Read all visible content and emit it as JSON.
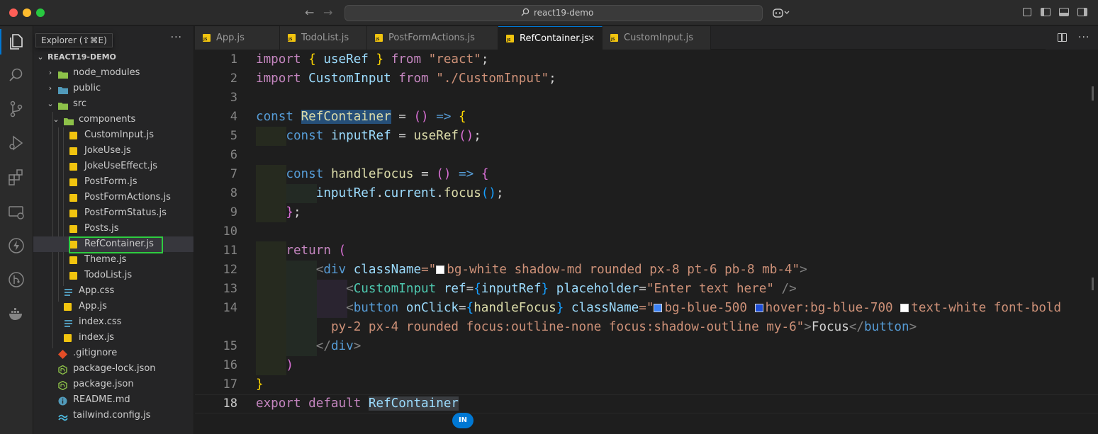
{
  "window": {
    "command_center_text": "react19-demo"
  },
  "explorer": {
    "tooltip": "Explorer (⇧⌘E)",
    "root": "REACT19-DEMO",
    "items": [
      {
        "label": "node_modules",
        "type": "folder",
        "expanded": false,
        "depth": 1,
        "icon": "folder-node-icon"
      },
      {
        "label": "public",
        "type": "folder",
        "expanded": false,
        "depth": 1,
        "icon": "folder-public-icon"
      },
      {
        "label": "src",
        "type": "folder",
        "expanded": true,
        "depth": 1,
        "icon": "folder-src-icon"
      },
      {
        "label": "components",
        "type": "folder",
        "expanded": true,
        "depth": 2,
        "icon": "folder-components-icon"
      },
      {
        "label": "CustomInput.js",
        "type": "js",
        "depth": 3
      },
      {
        "label": "JokeUse.js",
        "type": "js",
        "depth": 3
      },
      {
        "label": "JokeUseEffect.js",
        "type": "js",
        "depth": 3
      },
      {
        "label": "PostForm.js",
        "type": "js",
        "depth": 3
      },
      {
        "label": "PostFormActions.js",
        "type": "js",
        "depth": 3
      },
      {
        "label": "PostFormStatus.js",
        "type": "js",
        "depth": 3
      },
      {
        "label": "Posts.js",
        "type": "js",
        "depth": 3
      },
      {
        "label": "RefContainer.js",
        "type": "js",
        "depth": 3,
        "selected": true
      },
      {
        "label": "Theme.js",
        "type": "js",
        "depth": 3
      },
      {
        "label": "TodoList.js",
        "type": "js",
        "depth": 3
      },
      {
        "label": "App.css",
        "type": "css",
        "depth": 2
      },
      {
        "label": "App.js",
        "type": "js",
        "depth": 2
      },
      {
        "label": "index.css",
        "type": "css",
        "depth": 2
      },
      {
        "label": "index.js",
        "type": "js",
        "depth": 2
      },
      {
        "label": ".gitignore",
        "type": "git",
        "depth": 1
      },
      {
        "label": "package-lock.json",
        "type": "npm",
        "depth": 1
      },
      {
        "label": "package.json",
        "type": "npm",
        "depth": 1
      },
      {
        "label": "README.md",
        "type": "info",
        "depth": 1
      },
      {
        "label": "tailwind.config.js",
        "type": "tailwind",
        "depth": 1
      }
    ]
  },
  "tabs": [
    {
      "label": "App.js",
      "active": false
    },
    {
      "label": "TodoList.js",
      "active": false
    },
    {
      "label": "PostFormActions.js",
      "active": false
    },
    {
      "label": "RefContainer.js",
      "active": true
    },
    {
      "label": "CustomInput.js",
      "active": false
    }
  ],
  "tab_close_glyph": "✕",
  "editor": {
    "line_numbers": [
      "1",
      "2",
      "3",
      "4",
      "5",
      "6",
      "7",
      "8",
      "9",
      "10",
      "11",
      "12",
      "13",
      "14",
      "15",
      "16",
      "17",
      "18"
    ],
    "l1": {
      "a": "import",
      "b": "{",
      "c": "useRef",
      "d": "}",
      "e": "from",
      "f": "\"react\"",
      "g": ";"
    },
    "l2": {
      "a": "import",
      "b": "CustomInput",
      "c": "from",
      "d": "\"./CustomInput\"",
      "e": ";"
    },
    "l4": {
      "a": "const",
      "b": "RefContainer",
      "c": "=",
      "d": "()",
      "e": "=>",
      "f": "{"
    },
    "l5": {
      "a": "const",
      "b": "inputRef",
      "c": "=",
      "d": "useRef",
      "e": "()",
      "f": ";"
    },
    "l7": {
      "a": "const",
      "b": "handleFocus",
      "c": "=",
      "d": "()",
      "e": "=>",
      "f": "{"
    },
    "l8": {
      "a": "inputRef",
      "b": ".",
      "c": "current",
      "d": ".",
      "e": "focus",
      "f": "()",
      "g": ";"
    },
    "l9": {
      "a": "}",
      "b": ";"
    },
    "l11": {
      "a": "return",
      "b": "("
    },
    "l12": {
      "a": "<",
      "b": "div",
      "c": "className",
      "d": "=\"",
      "e": "bg-white shadow-md rounded px-8 pt-6 pb-8 mb-4",
      "f": "\"",
      "g": ">"
    },
    "l13": {
      "a": "<",
      "b": "CustomInput",
      "c": "ref",
      "d": "=",
      "e": "{",
      "f": "inputRef",
      "g": "}",
      "h": "placeholder",
      "i": "=",
      "j": "\"Enter text here\"",
      "k": "/>"
    },
    "l14": {
      "a": "<",
      "b": "button",
      "c": "onClick",
      "d": "=",
      "e": "{",
      "f": "handleFocus",
      "g": "}",
      "h": "className",
      "i": "=\"",
      "j": "bg-blue-500",
      "k": "hover:bg-blue-700",
      "l": "text-white font-bold"
    },
    "l14w": {
      "a": "py-2 px-4 rounded focus:outline-none focus:shadow-outline my-6",
      "b": "\"",
      "c": ">",
      "d": "Focus",
      "e": "</",
      "f": "button",
      "g": ">"
    },
    "l15": {
      "a": "</",
      "b": "div",
      "c": ">"
    },
    "l16": {
      "a": ")"
    },
    "l17": {
      "a": "}"
    },
    "l18": {
      "a": "export",
      "b": "default",
      "c": "RefContainer"
    }
  },
  "colors": {
    "swatch_white": "#ffffff",
    "swatch_blue_500": "#3b82f6",
    "swatch_blue_700": "#1d4ed8"
  },
  "status": {
    "mode_pill": "IN"
  }
}
